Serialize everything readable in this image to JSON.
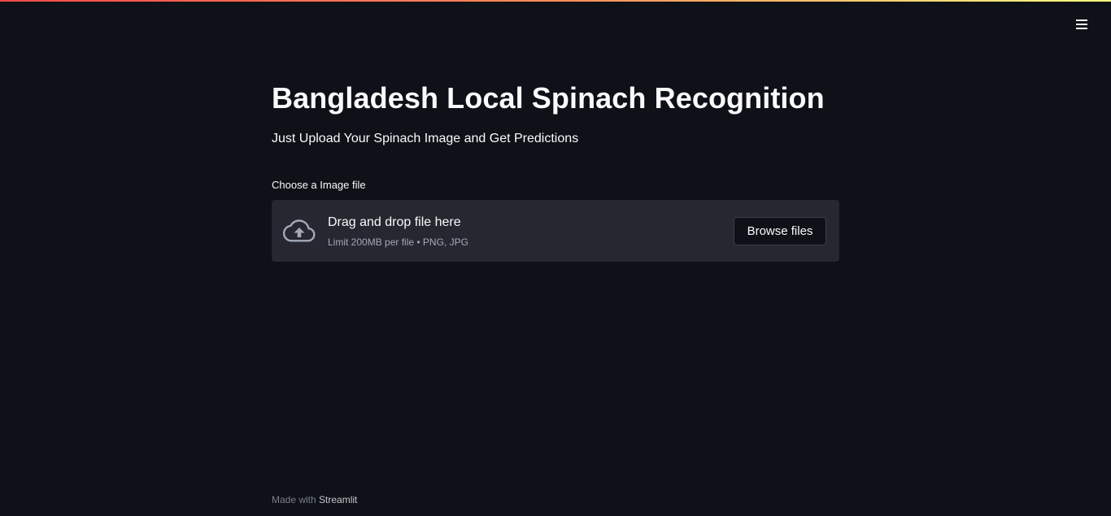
{
  "header": {
    "menu_icon": "hamburger-icon",
    "accent_gradient": [
      "#ff4b4b",
      "#fffd80"
    ]
  },
  "main": {
    "title": "Bangladesh Local Spinach Recognition",
    "subtitle": "Just Upload Your Spinach Image and Get Predictions"
  },
  "uploader": {
    "label": "Choose a Image file",
    "icon": "cloud-upload-icon",
    "instructions": "Drag and drop file here",
    "limit": "Limit 200MB per file • PNG, JPG",
    "button_label": "Browse files"
  },
  "footer": {
    "prefix": "Made with",
    "brand": "Streamlit"
  },
  "colors": {
    "background": "#0e1117",
    "dropzone": "#262730",
    "text": "#fafafa"
  }
}
